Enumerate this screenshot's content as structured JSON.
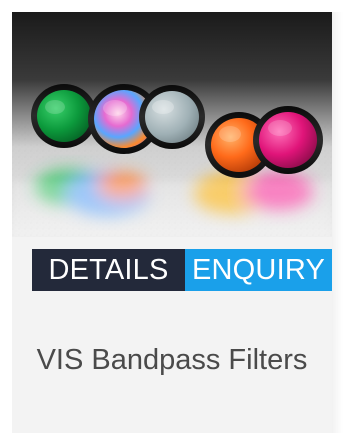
{
  "card": {
    "title": "VIS Bandpass Filters",
    "image_alt": "VIS Bandpass Filters",
    "buttons": {
      "details_label": "DETAILS",
      "enquiry_label": "ENQUIRY"
    }
  },
  "colors": {
    "details_button_bg": "#23293a",
    "enquiry_button_bg": "#1aa0ea",
    "card_bg": "#f3f3f3",
    "title_text": "#4a4a4a"
  }
}
